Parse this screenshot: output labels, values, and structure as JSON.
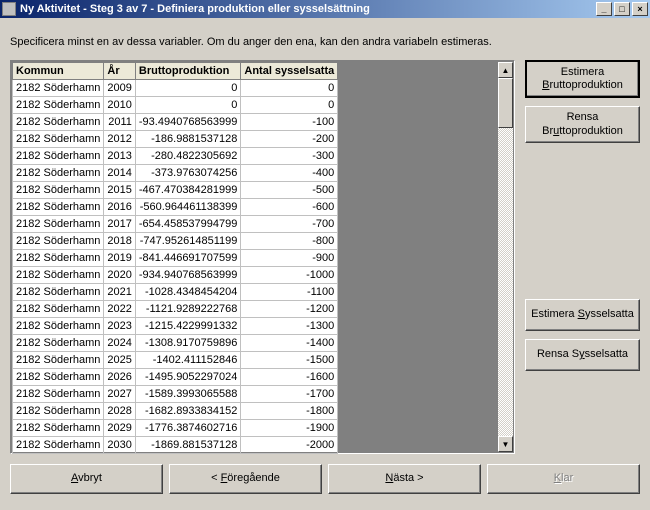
{
  "window": {
    "title": "Ny Aktivitet - Steg 3 av 7 - Definiera produktion eller sysselsättning"
  },
  "instruction": "Specificera minst en av dessa variabler. Om du anger den ena, kan den andra variabeln estimeras.",
  "columns": {
    "kommun": "Kommun",
    "ar": "År",
    "brutto": "Bruttoproduktion",
    "antal": "Antal sysselsatta"
  },
  "rows": [
    {
      "kommun": "2182 Söderhamn",
      "ar": "2009",
      "brutto": "0",
      "antal": "0"
    },
    {
      "kommun": "2182 Söderhamn",
      "ar": "2010",
      "brutto": "0",
      "antal": "0"
    },
    {
      "kommun": "2182 Söderhamn",
      "ar": "2011",
      "brutto": "-93.4940768563999",
      "antal": "-100"
    },
    {
      "kommun": "2182 Söderhamn",
      "ar": "2012",
      "brutto": "-186.9881537128",
      "antal": "-200"
    },
    {
      "kommun": "2182 Söderhamn",
      "ar": "2013",
      "brutto": "-280.4822305692",
      "antal": "-300"
    },
    {
      "kommun": "2182 Söderhamn",
      "ar": "2014",
      "brutto": "-373.9763074256",
      "antal": "-400"
    },
    {
      "kommun": "2182 Söderhamn",
      "ar": "2015",
      "brutto": "-467.470384281999",
      "antal": "-500"
    },
    {
      "kommun": "2182 Söderhamn",
      "ar": "2016",
      "brutto": "-560.964461138399",
      "antal": "-600"
    },
    {
      "kommun": "2182 Söderhamn",
      "ar": "2017",
      "brutto": "-654.458537994799",
      "antal": "-700"
    },
    {
      "kommun": "2182 Söderhamn",
      "ar": "2018",
      "brutto": "-747.952614851199",
      "antal": "-800"
    },
    {
      "kommun": "2182 Söderhamn",
      "ar": "2019",
      "brutto": "-841.446691707599",
      "antal": "-900"
    },
    {
      "kommun": "2182 Söderhamn",
      "ar": "2020",
      "brutto": "-934.940768563999",
      "antal": "-1000"
    },
    {
      "kommun": "2182 Söderhamn",
      "ar": "2021",
      "brutto": "-1028.4348454204",
      "antal": "-1100"
    },
    {
      "kommun": "2182 Söderhamn",
      "ar": "2022",
      "brutto": "-1121.9289222768",
      "antal": "-1200"
    },
    {
      "kommun": "2182 Söderhamn",
      "ar": "2023",
      "brutto": "-1215.4229991332",
      "antal": "-1300"
    },
    {
      "kommun": "2182 Söderhamn",
      "ar": "2024",
      "brutto": "-1308.9170759896",
      "antal": "-1400"
    },
    {
      "kommun": "2182 Söderhamn",
      "ar": "2025",
      "brutto": "-1402.411152846",
      "antal": "-1500"
    },
    {
      "kommun": "2182 Söderhamn",
      "ar": "2026",
      "brutto": "-1495.9052297024",
      "antal": "-1600"
    },
    {
      "kommun": "2182 Söderhamn",
      "ar": "2027",
      "brutto": "-1589.3993065588",
      "antal": "-1700"
    },
    {
      "kommun": "2182 Söderhamn",
      "ar": "2028",
      "brutto": "-1682.8933834152",
      "antal": "-1800"
    },
    {
      "kommun": "2182 Söderhamn",
      "ar": "2029",
      "brutto": "-1776.3874602716",
      "antal": "-1900"
    },
    {
      "kommun": "2182 Söderhamn",
      "ar": "2030",
      "brutto": "-1869.881537128",
      "antal": "-2000"
    }
  ],
  "sideButtons": {
    "estBrutto_pre": "Estimera ",
    "estBrutto_ul": "B",
    "estBrutto_post": "ruttoproduktion",
    "rensaBrutto_pre": "Rensa Br",
    "rensaBrutto_ul": "u",
    "rensaBrutto_post": "ttoproduktion",
    "estSyss_pre": "Estimera ",
    "estSyss_ul": "S",
    "estSyss_post": "ysselsatta",
    "rensaSyss_pre": "Rensa S",
    "rensaSyss_ul": "y",
    "rensaSyss_post": "sselsatta"
  },
  "bottomButtons": {
    "avbryt_ul": "A",
    "avbryt_post": "vbryt",
    "foreg_pre": "< ",
    "foreg_ul": "F",
    "foreg_post": "öregående",
    "nasta_ul": "N",
    "nasta_post": "ästa >",
    "klar_ul": "K",
    "klar_post": "lar"
  }
}
